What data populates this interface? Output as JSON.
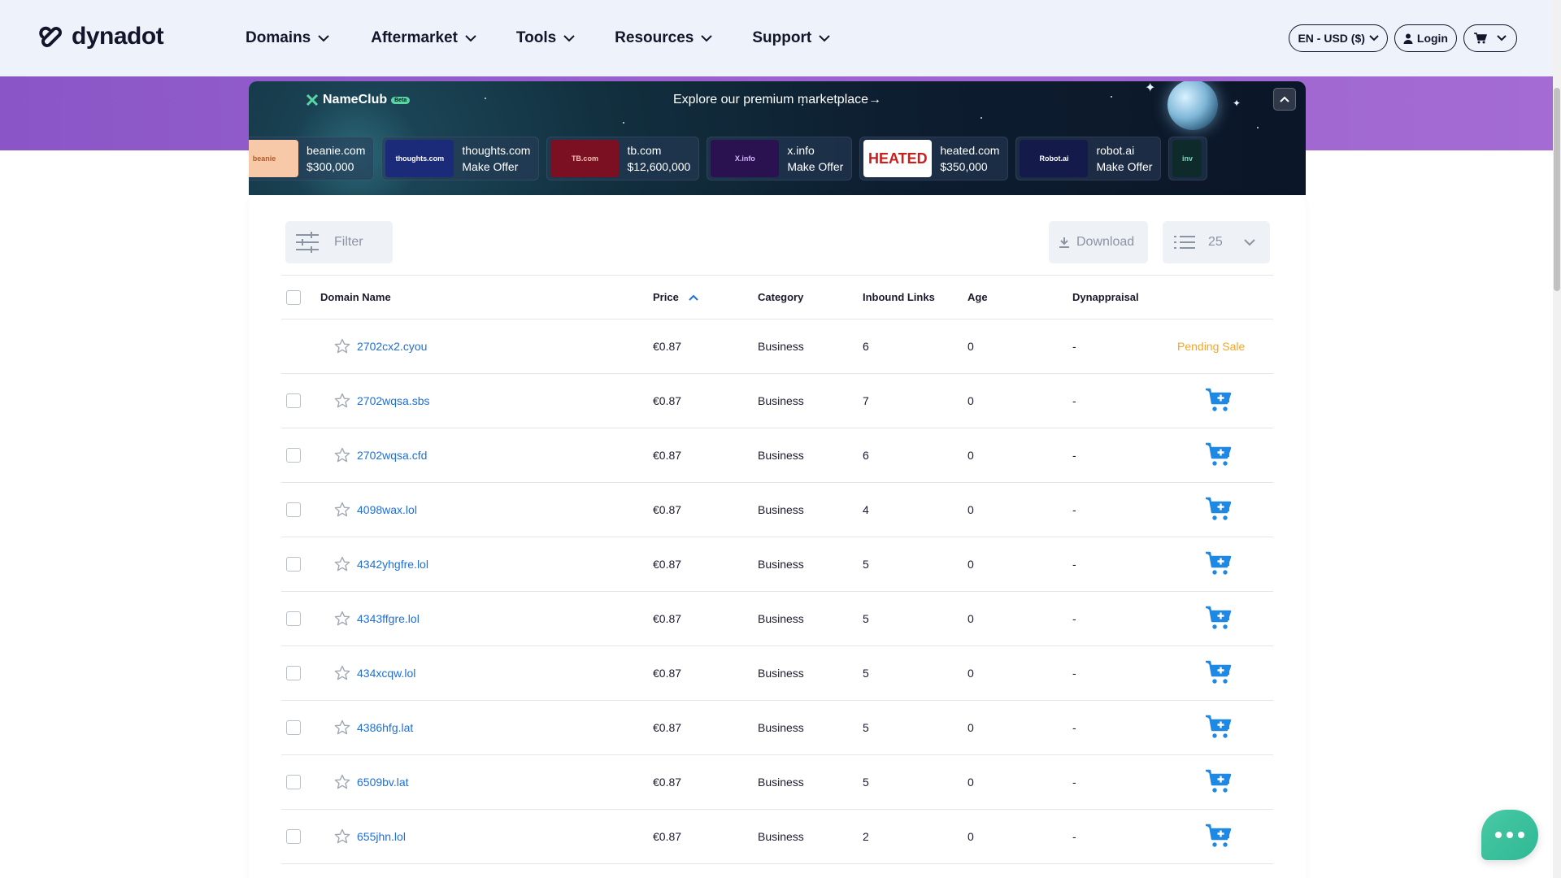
{
  "header": {
    "brand": "dynadot",
    "nav": [
      "Domains",
      "Aftermarket",
      "Tools",
      "Resources",
      "Support"
    ],
    "locale": "EN - USD ($)",
    "login": "Login"
  },
  "banner": {
    "brand": "NameClub",
    "badge": "Beta",
    "headline": "Explore our premium marketplace",
    "cards": [
      {
        "thumb": "beanie",
        "domain": "beanie.com",
        "price": "$300,000",
        "bg": "#f7c9a8",
        "fg": "#b25a2a"
      },
      {
        "thumb": "thoughts.com",
        "domain": "thoughts.com",
        "price": "Make Offer",
        "bg": "#1c2a7a",
        "fg": "#ffffff"
      },
      {
        "thumb": "TB.com",
        "domain": "tb.com",
        "price": "$12,600,000",
        "bg": "#7a1022",
        "fg": "#f4c2b0"
      },
      {
        "thumb": "X.info",
        "domain": "x.info",
        "price": "Make Offer",
        "bg": "#2a1250",
        "fg": "#d4b8ff"
      },
      {
        "thumb": "HEATED",
        "domain": "heated.com",
        "price": "$350,000",
        "bg": "#ffffff",
        "fg": "#c81e1e"
      },
      {
        "thumb": "Robot.ai",
        "domain": "robot.ai",
        "price": "Make Offer",
        "bg": "#141a4a",
        "fg": "#ffffff"
      },
      {
        "thumb": "inv",
        "domain": "",
        "price": "",
        "bg": "#0f2a2a",
        "fg": "#6fe0c0"
      }
    ]
  },
  "toolbar": {
    "filter": "Filter",
    "download": "Download",
    "page_size": "25"
  },
  "table": {
    "columns": [
      "Domain Name",
      "Price",
      "Category",
      "Inbound Links",
      "Age",
      "Dynappraisal"
    ],
    "rows": [
      {
        "domain": "2702cx2.cyou",
        "price": "€0.87",
        "category": "Business",
        "links": "6",
        "age": "0",
        "appraisal": "-",
        "status": "Pending Sale"
      },
      {
        "domain": "2702wqsa.sbs",
        "price": "€0.87",
        "category": "Business",
        "links": "7",
        "age": "0",
        "appraisal": "-",
        "status": "cart"
      },
      {
        "domain": "2702wqsa.cfd",
        "price": "€0.87",
        "category": "Business",
        "links": "6",
        "age": "0",
        "appraisal": "-",
        "status": "cart"
      },
      {
        "domain": "4098wax.lol",
        "price": "€0.87",
        "category": "Business",
        "links": "4",
        "age": "0",
        "appraisal": "-",
        "status": "cart"
      },
      {
        "domain": "4342yhgfre.lol",
        "price": "€0.87",
        "category": "Business",
        "links": "5",
        "age": "0",
        "appraisal": "-",
        "status": "cart"
      },
      {
        "domain": "4343ffgre.lol",
        "price": "€0.87",
        "category": "Business",
        "links": "5",
        "age": "0",
        "appraisal": "-",
        "status": "cart"
      },
      {
        "domain": "434xcqw.lol",
        "price": "€0.87",
        "category": "Business",
        "links": "5",
        "age": "0",
        "appraisal": "-",
        "status": "cart"
      },
      {
        "domain": "4386hfg.lat",
        "price": "€0.87",
        "category": "Business",
        "links": "5",
        "age": "0",
        "appraisal": "-",
        "status": "cart"
      },
      {
        "domain": "6509bv.lat",
        "price": "€0.87",
        "category": "Business",
        "links": "5",
        "age": "0",
        "appraisal": "-",
        "status": "cart"
      },
      {
        "domain": "655jhn.lol",
        "price": "€0.87",
        "category": "Business",
        "links": "2",
        "age": "0",
        "appraisal": "-",
        "status": "cart"
      }
    ]
  },
  "colors": {
    "accent": "#1e6fd8",
    "pending": "#f5a623",
    "band": "#9c62cf",
    "chat": "#3fc19c"
  }
}
